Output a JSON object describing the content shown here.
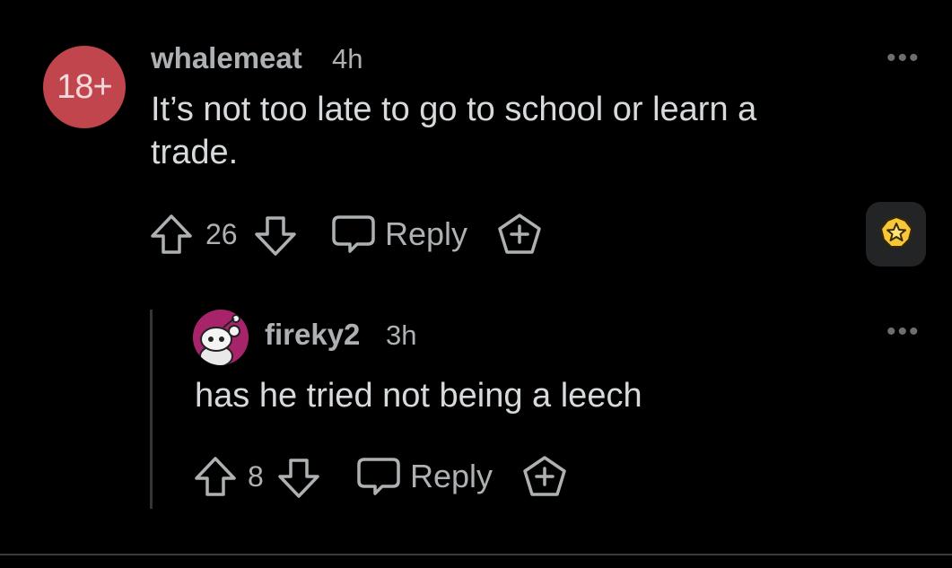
{
  "comment": {
    "avatar_text": "18+",
    "username": "whalemeat",
    "time": "4h",
    "body": "It’s not too late to go to school or learn a trade.",
    "votes": "26",
    "reply_label": "Reply",
    "more_label": "•••"
  },
  "reply": {
    "username": "fireky2",
    "time": "3h",
    "body": "has he tried not being a leech",
    "votes": "8",
    "reply_label": "Reply",
    "more_label": "•••"
  },
  "colors": {
    "background": "#000000",
    "avatar_red": "#c0454c",
    "award_gold": "#f7c63b"
  }
}
